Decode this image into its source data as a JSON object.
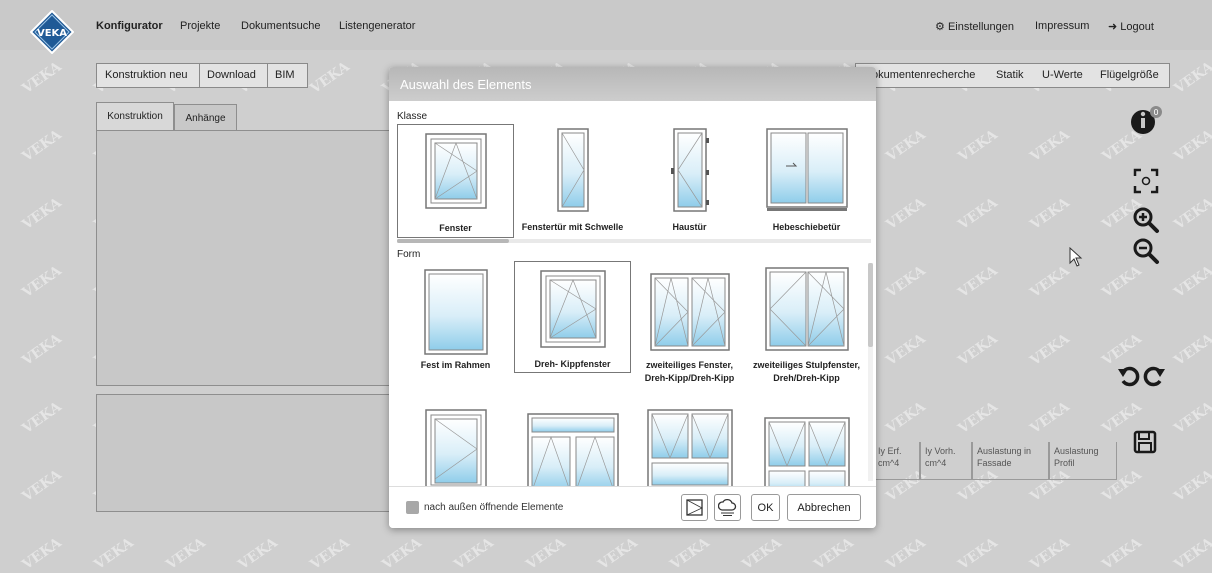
{
  "nav": {
    "items": [
      "Konfigurator",
      "Projekte",
      "Dokumentsuche",
      "Listengenerator"
    ],
    "settings": "Einstellungen",
    "impressum": "Impressum",
    "logout": "Logout",
    "logo_text": "VEKA"
  },
  "toolbar": {
    "new": "Konstruktion neu",
    "download": "Download",
    "bim": "BIM",
    "right_items": [
      "okumentenrecherche",
      "Statik",
      "U-Werte",
      "Flügelgröße"
    ]
  },
  "tabs": [
    "Konstruktion",
    "Anhänge"
  ],
  "table_headers": [
    "Iy Erf.\ncm^4",
    "Iy Vorh.\ncm^4",
    "Auslastung in\nFassade",
    "Auslastung\nProfil"
  ],
  "modal": {
    "title": "Auswahl des Elements",
    "klasse_label": "Klasse",
    "form_label": "Form",
    "klasse": [
      "Fenster",
      "Fenstertür mit Schwelle",
      "Haustür",
      "Hebeschiebetür"
    ],
    "form": [
      "Fest im Rahmen",
      "Dreh- Kippfenster",
      "zweiteiliges Fenster, Dreh-Kipp/Dreh-Kipp",
      "zweiteiliges Stulpfenster, Dreh/Dreh-Kipp"
    ],
    "checkbox_label": "nach außen öffnende Elemente",
    "ok": "OK",
    "cancel": "Abbrechen"
  },
  "colors": {
    "logo": "#1f5a96",
    "glass": "#9fd3ec",
    "header": "#bdbdbd"
  }
}
